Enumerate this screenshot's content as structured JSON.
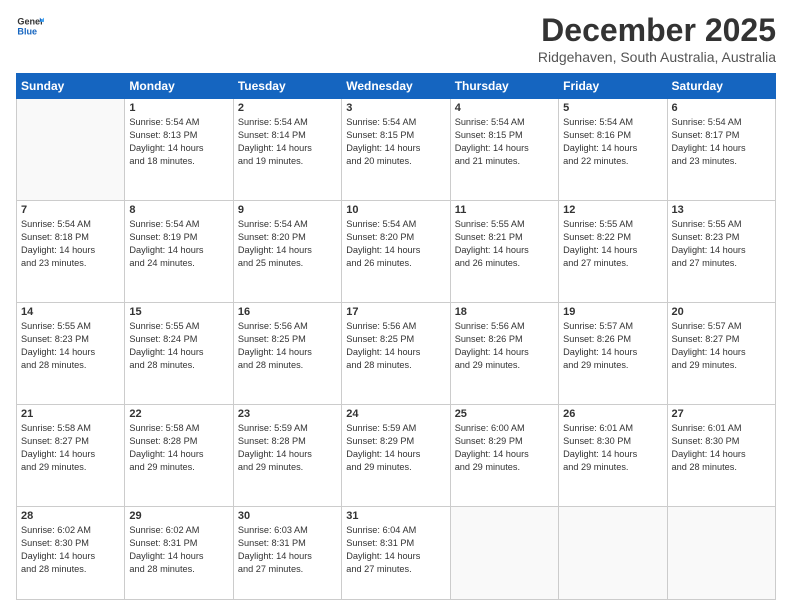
{
  "logo": {
    "line1": "General",
    "line2": "Blue"
  },
  "title": "December 2025",
  "location": "Ridgehaven, South Australia, Australia",
  "days": [
    "Sunday",
    "Monday",
    "Tuesday",
    "Wednesday",
    "Thursday",
    "Friday",
    "Saturday"
  ],
  "weeks": [
    [
      {
        "num": "",
        "text": ""
      },
      {
        "num": "1",
        "text": "Sunrise: 5:54 AM\nSunset: 8:13 PM\nDaylight: 14 hours\nand 18 minutes."
      },
      {
        "num": "2",
        "text": "Sunrise: 5:54 AM\nSunset: 8:14 PM\nDaylight: 14 hours\nand 19 minutes."
      },
      {
        "num": "3",
        "text": "Sunrise: 5:54 AM\nSunset: 8:15 PM\nDaylight: 14 hours\nand 20 minutes."
      },
      {
        "num": "4",
        "text": "Sunrise: 5:54 AM\nSunset: 8:15 PM\nDaylight: 14 hours\nand 21 minutes."
      },
      {
        "num": "5",
        "text": "Sunrise: 5:54 AM\nSunset: 8:16 PM\nDaylight: 14 hours\nand 22 minutes."
      },
      {
        "num": "6",
        "text": "Sunrise: 5:54 AM\nSunset: 8:17 PM\nDaylight: 14 hours\nand 23 minutes."
      }
    ],
    [
      {
        "num": "7",
        "text": "Sunrise: 5:54 AM\nSunset: 8:18 PM\nDaylight: 14 hours\nand 23 minutes."
      },
      {
        "num": "8",
        "text": "Sunrise: 5:54 AM\nSunset: 8:19 PM\nDaylight: 14 hours\nand 24 minutes."
      },
      {
        "num": "9",
        "text": "Sunrise: 5:54 AM\nSunset: 8:20 PM\nDaylight: 14 hours\nand 25 minutes."
      },
      {
        "num": "10",
        "text": "Sunrise: 5:54 AM\nSunset: 8:20 PM\nDaylight: 14 hours\nand 26 minutes."
      },
      {
        "num": "11",
        "text": "Sunrise: 5:55 AM\nSunset: 8:21 PM\nDaylight: 14 hours\nand 26 minutes."
      },
      {
        "num": "12",
        "text": "Sunrise: 5:55 AM\nSunset: 8:22 PM\nDaylight: 14 hours\nand 27 minutes."
      },
      {
        "num": "13",
        "text": "Sunrise: 5:55 AM\nSunset: 8:23 PM\nDaylight: 14 hours\nand 27 minutes."
      }
    ],
    [
      {
        "num": "14",
        "text": "Sunrise: 5:55 AM\nSunset: 8:23 PM\nDaylight: 14 hours\nand 28 minutes."
      },
      {
        "num": "15",
        "text": "Sunrise: 5:55 AM\nSunset: 8:24 PM\nDaylight: 14 hours\nand 28 minutes."
      },
      {
        "num": "16",
        "text": "Sunrise: 5:56 AM\nSunset: 8:25 PM\nDaylight: 14 hours\nand 28 minutes."
      },
      {
        "num": "17",
        "text": "Sunrise: 5:56 AM\nSunset: 8:25 PM\nDaylight: 14 hours\nand 28 minutes."
      },
      {
        "num": "18",
        "text": "Sunrise: 5:56 AM\nSunset: 8:26 PM\nDaylight: 14 hours\nand 29 minutes."
      },
      {
        "num": "19",
        "text": "Sunrise: 5:57 AM\nSunset: 8:26 PM\nDaylight: 14 hours\nand 29 minutes."
      },
      {
        "num": "20",
        "text": "Sunrise: 5:57 AM\nSunset: 8:27 PM\nDaylight: 14 hours\nand 29 minutes."
      }
    ],
    [
      {
        "num": "21",
        "text": "Sunrise: 5:58 AM\nSunset: 8:27 PM\nDaylight: 14 hours\nand 29 minutes."
      },
      {
        "num": "22",
        "text": "Sunrise: 5:58 AM\nSunset: 8:28 PM\nDaylight: 14 hours\nand 29 minutes."
      },
      {
        "num": "23",
        "text": "Sunrise: 5:59 AM\nSunset: 8:28 PM\nDaylight: 14 hours\nand 29 minutes."
      },
      {
        "num": "24",
        "text": "Sunrise: 5:59 AM\nSunset: 8:29 PM\nDaylight: 14 hours\nand 29 minutes."
      },
      {
        "num": "25",
        "text": "Sunrise: 6:00 AM\nSunset: 8:29 PM\nDaylight: 14 hours\nand 29 minutes."
      },
      {
        "num": "26",
        "text": "Sunrise: 6:01 AM\nSunset: 8:30 PM\nDaylight: 14 hours\nand 29 minutes."
      },
      {
        "num": "27",
        "text": "Sunrise: 6:01 AM\nSunset: 8:30 PM\nDaylight: 14 hours\nand 28 minutes."
      }
    ],
    [
      {
        "num": "28",
        "text": "Sunrise: 6:02 AM\nSunset: 8:30 PM\nDaylight: 14 hours\nand 28 minutes."
      },
      {
        "num": "29",
        "text": "Sunrise: 6:02 AM\nSunset: 8:31 PM\nDaylight: 14 hours\nand 28 minutes."
      },
      {
        "num": "30",
        "text": "Sunrise: 6:03 AM\nSunset: 8:31 PM\nDaylight: 14 hours\nand 27 minutes."
      },
      {
        "num": "31",
        "text": "Sunrise: 6:04 AM\nSunset: 8:31 PM\nDaylight: 14 hours\nand 27 minutes."
      },
      {
        "num": "",
        "text": ""
      },
      {
        "num": "",
        "text": ""
      },
      {
        "num": "",
        "text": ""
      }
    ]
  ]
}
